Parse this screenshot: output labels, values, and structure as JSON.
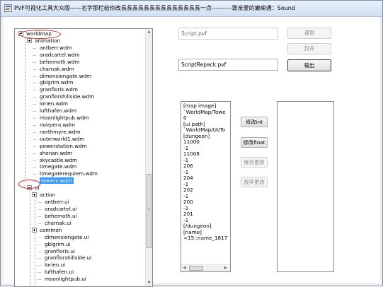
{
  "window": {
    "title": "PVF可视化工具大众版——名字那栏给你改長長長長長長長長長長長長長長一点----------致亲爱的癫痫通：Sound"
  },
  "tree": {
    "items": [
      {
        "label": "worldmap",
        "expander": "minus"
      },
      {
        "label": "animation",
        "expander": "plus"
      },
      {
        "label": "antberr.wdm"
      },
      {
        "label": "aradcartel.wdm"
      },
      {
        "label": "behemoth.wdm"
      },
      {
        "label": "charnak.wdm"
      },
      {
        "label": "dimensiongate.wdm"
      },
      {
        "label": "gblgrim.wdm"
      },
      {
        "label": "granfloris.wdm"
      },
      {
        "label": "granflorshillside.wdm"
      },
      {
        "label": "lorien.wdm"
      },
      {
        "label": "lufthafen.wdm"
      },
      {
        "label": "moonlightpub.wdm"
      },
      {
        "label": "noirpera.wdm"
      },
      {
        "label": "northmyre.wdm"
      },
      {
        "label": "outerworld1.wdm"
      },
      {
        "label": "powerstation.wdm"
      },
      {
        "label": "shonan.wdm"
      },
      {
        "label": "skycastle.wdm"
      },
      {
        "label": "timegate.wdm"
      },
      {
        "label": "timegaterequiem.wdm"
      },
      {
        "label": "towers.wdm",
        "selected": true
      },
      {
        "label": "ui",
        "expander": "minus"
      },
      {
        "label": "action",
        "expander": "plus"
      },
      {
        "label": "antberr.ui"
      },
      {
        "label": "aradcartel.ui"
      },
      {
        "label": "behemoth.ui"
      },
      {
        "label": "charnak.ui"
      },
      {
        "label": "common",
        "expander": "plus"
      },
      {
        "label": "dimensiongate.ui"
      },
      {
        "label": "gblgrim.ui"
      },
      {
        "label": "granfloris.ui"
      },
      {
        "label": "granflorshillside.ui"
      },
      {
        "label": "lorien.ui"
      },
      {
        "label": "lufthafen.ui"
      },
      {
        "label": "moonlightpub.ui"
      }
    ]
  },
  "fields": {
    "script_path": "Script.pvf",
    "repack_path": "ScriptRepack.pvf"
  },
  "buttons": {
    "read": "读取",
    "pack": "封开",
    "output": "输出",
    "modify_int": "修改int",
    "modify_float": "修改float",
    "save_changes": "保存更改",
    "discard_changes": "放弃更改"
  },
  "content": {
    "lines": [
      "[map image]",
      "`WorldMap/Towe",
      "0",
      "[ui path]",
      "`WorldMap/UI/To",
      "[dungeon]",
      "11000",
      "-1",
      "11008",
      "-1",
      "206",
      "-1",
      "204",
      "-1",
      "202",
      "-1",
      "200",
      "-1",
      "201",
      "-1",
      "[/dungeon]",
      "[name]",
      "<15::name_1817"
    ]
  },
  "icons": {
    "scroll_up": "▲",
    "scroll_down": "▼",
    "scroll_left": "◀",
    "scroll_right": "▶",
    "grip": "⦀"
  },
  "colors": {
    "selection": "#3399ff",
    "annotation_circle": "#e02020"
  }
}
